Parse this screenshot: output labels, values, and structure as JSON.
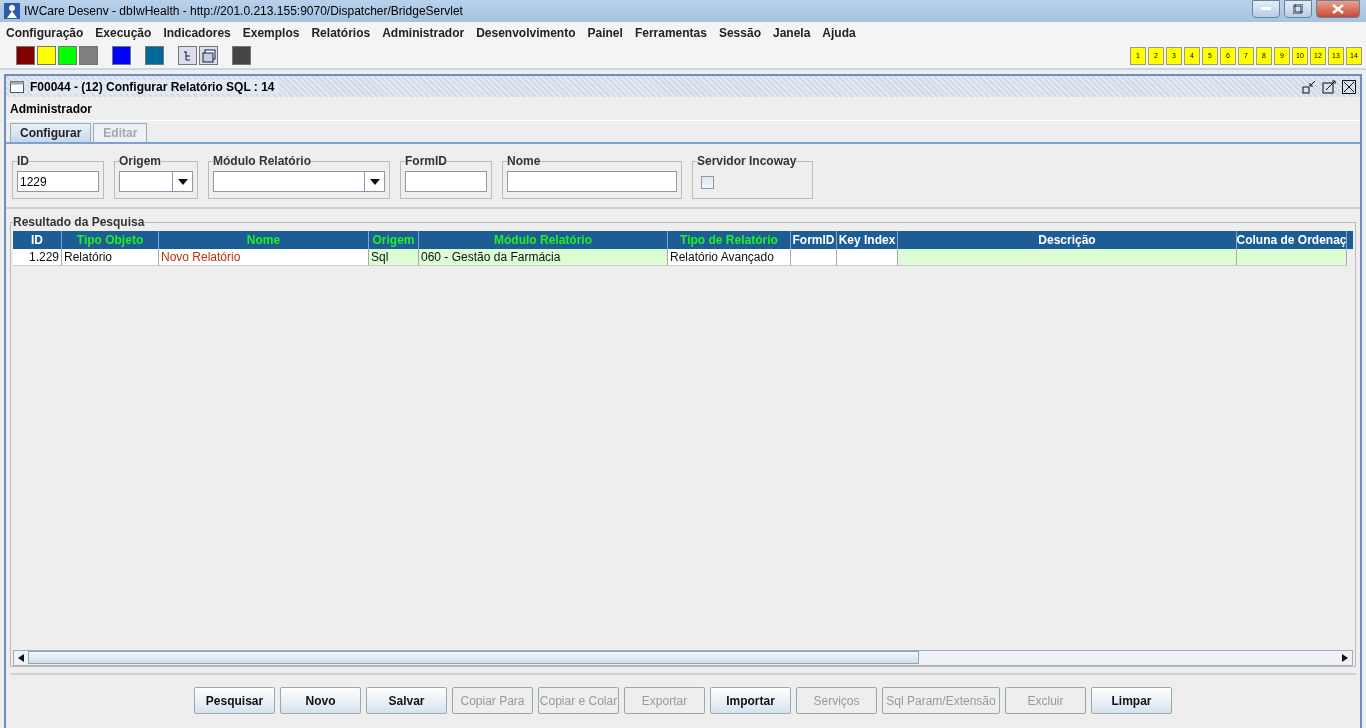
{
  "window": {
    "title": "IWCare Desenv - dbIwHealth - http://201.0.213.155:9070/Dispatcher/BridgeServlet"
  },
  "menu": [
    "Configuração",
    "Execução",
    "Indicadores",
    "Exemplos",
    "Relatórios",
    "Administrador",
    "Desenvolvimento",
    "Painel",
    "Ferramentas",
    "Sessão",
    "Janela",
    "Ajuda"
  ],
  "toolbar": {
    "swatches": [
      {
        "color": "#800000"
      },
      {
        "color": "#ffff00"
      },
      {
        "color": "#00ff00"
      },
      {
        "color": "#808080"
      },
      {
        "color": "#0000ff"
      },
      {
        "color": "#00699a"
      },
      {
        "color": "#444444"
      }
    ],
    "window_numbers": [
      "1",
      "2",
      "3",
      "4",
      "5",
      "6",
      "7",
      "8",
      "9",
      "10",
      "12",
      "13",
      "14"
    ]
  },
  "frame": {
    "title": "F00044 - (12) Configurar Relatório SQL : 14",
    "section": "Administrador",
    "tabs": [
      {
        "label": "Configurar",
        "selected": true,
        "disabled": false
      },
      {
        "label": "Editar",
        "selected": false,
        "disabled": true
      }
    ],
    "filters": [
      {
        "kind": "text",
        "label": "ID",
        "value": "1229"
      },
      {
        "kind": "select",
        "label": "Origem"
      },
      {
        "kind": "select",
        "label": "Módulo Relatório"
      },
      {
        "kind": "text",
        "label": "FormID"
      },
      {
        "kind": "text",
        "label": "Nome"
      },
      {
        "kind": "checkbox",
        "label": "Servidor Incoway",
        "checked": false
      }
    ],
    "results": {
      "title": "Resultado da Pesquisa",
      "columns": [
        {
          "label": "ID",
          "highlighted": false
        },
        {
          "label": "Tipo Objeto",
          "highlighted": true
        },
        {
          "label": "Nome",
          "highlighted": true
        },
        {
          "label": "Origem",
          "highlighted": true
        },
        {
          "label": "Módulo Relatório",
          "highlighted": true
        },
        {
          "label": "Tipo de Relatório",
          "highlighted": true
        },
        {
          "label": "FormID",
          "highlighted": false
        },
        {
          "label": "Key Index",
          "highlighted": false
        },
        {
          "label": "Descrição",
          "highlighted": false
        },
        {
          "label": "Coluna de Ordenaç",
          "highlighted": false
        }
      ],
      "rows": [
        {
          "cells": [
            {
              "text": "1.229",
              "shaded": false,
              "emphasis": false
            },
            {
              "text": "Relatório",
              "shaded": false,
              "emphasis": false
            },
            {
              "text": "Novo Relatório",
              "shaded": false,
              "emphasis": true
            },
            {
              "text": "Sql",
              "shaded": true,
              "emphasis": false
            },
            {
              "text": "060 - Gestão da Farmácia",
              "shaded": true,
              "emphasis": false
            },
            {
              "text": "Relatório Avançado",
              "shaded": false,
              "emphasis": false
            },
            {
              "shaded": false
            },
            {
              "shaded": false
            },
            {
              "shaded": true
            },
            {
              "shaded": true
            }
          ]
        }
      ]
    },
    "buttons": [
      {
        "label": "Pesquisar",
        "disabled": false
      },
      {
        "label": "Novo",
        "disabled": false
      },
      {
        "label": "Salvar",
        "disabled": false
      },
      {
        "label": "Copiar Para",
        "disabled": true
      },
      {
        "label": "Copiar e Colar",
        "disabled": true
      },
      {
        "label": "Exportar",
        "disabled": true
      },
      {
        "label": "Importar",
        "disabled": false
      },
      {
        "label": "Serviços",
        "disabled": true
      },
      {
        "label": "Sql Param/Extensão",
        "disabled": true
      },
      {
        "label": "Excluir",
        "disabled": true
      },
      {
        "label": "Limpar",
        "disabled": false
      }
    ]
  }
}
